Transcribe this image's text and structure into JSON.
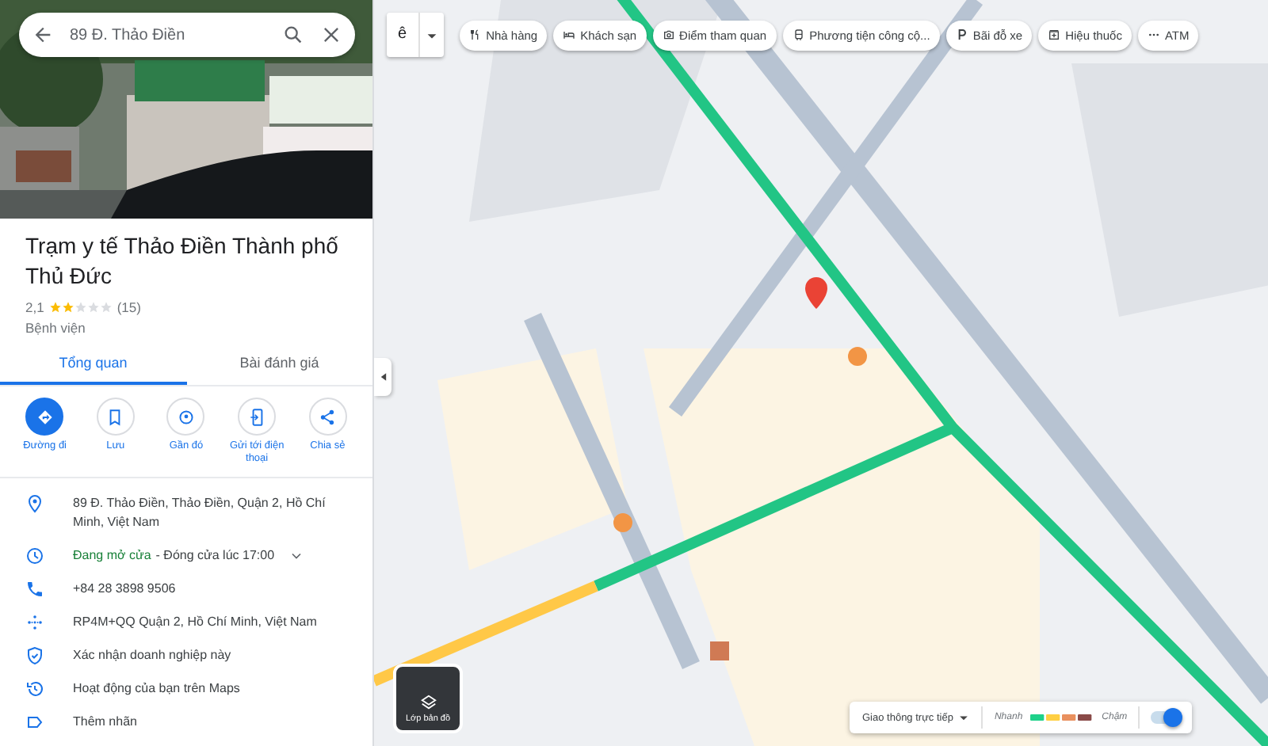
{
  "search": {
    "value": "89 Đ. Thảo Điền"
  },
  "place": {
    "title": "Trạm y tế Thảo Điền Thành phố Thủ Đức",
    "rating": "2,1",
    "stars": 2,
    "review_count": "(15)",
    "category": "Bệnh viện"
  },
  "tabs": [
    {
      "label": "Tổng quan",
      "selected": true
    },
    {
      "label": "Bài đánh giá",
      "selected": false
    }
  ],
  "actions": [
    {
      "label": "Đường đi",
      "kind": "directions",
      "primary": true
    },
    {
      "label": "Lưu",
      "kind": "save",
      "primary": false
    },
    {
      "label": "Gần đó",
      "kind": "nearby",
      "primary": false
    },
    {
      "label": "Gửi tới điện thoại",
      "kind": "send",
      "primary": false
    },
    {
      "label": "Chia sẻ",
      "kind": "share",
      "primary": false
    }
  ],
  "info": [
    {
      "kind": "address",
      "text": "89 Đ. Thảo Điền, Thảo Điền, Quận 2, Hồ Chí Minh, Việt Nam"
    },
    {
      "kind": "hours",
      "status": "Đang mở cửa",
      "text": "- Đóng cửa lúc 17:00"
    },
    {
      "kind": "phone",
      "text": "+84 28 3898 9506"
    },
    {
      "kind": "pluscode",
      "text": "RP4M+QQ Quận 2, Hồ Chí Minh, Việt Nam"
    },
    {
      "kind": "claim",
      "text": "Xác nhận doanh nghiệp này"
    },
    {
      "kind": "history",
      "text": "Hoạt động của bạn trên Maps"
    },
    {
      "kind": "label",
      "text": "Thêm nhãn"
    }
  ],
  "map": {
    "language_box": {
      "value": "ê"
    },
    "chips": [
      {
        "label": "Nhà hàng",
        "kind": "restaurant"
      },
      {
        "label": "Khách sạn",
        "kind": "hotel"
      },
      {
        "label": "Điểm tham quan",
        "kind": "camera"
      },
      {
        "label": "Phương tiện công cộ...",
        "kind": "transit"
      },
      {
        "label": "Bãi đỗ xe",
        "kind": "parking"
      },
      {
        "label": "Hiệu thuốc",
        "kind": "pharmacy"
      },
      {
        "label": "ATM",
        "kind": "more"
      }
    ],
    "layer_button": {
      "label": "Lớp bản đồ"
    },
    "traffic": {
      "label": "Giao thông trực tiếp",
      "fast": "Nhanh",
      "slow": "Chậm",
      "on": true
    }
  }
}
